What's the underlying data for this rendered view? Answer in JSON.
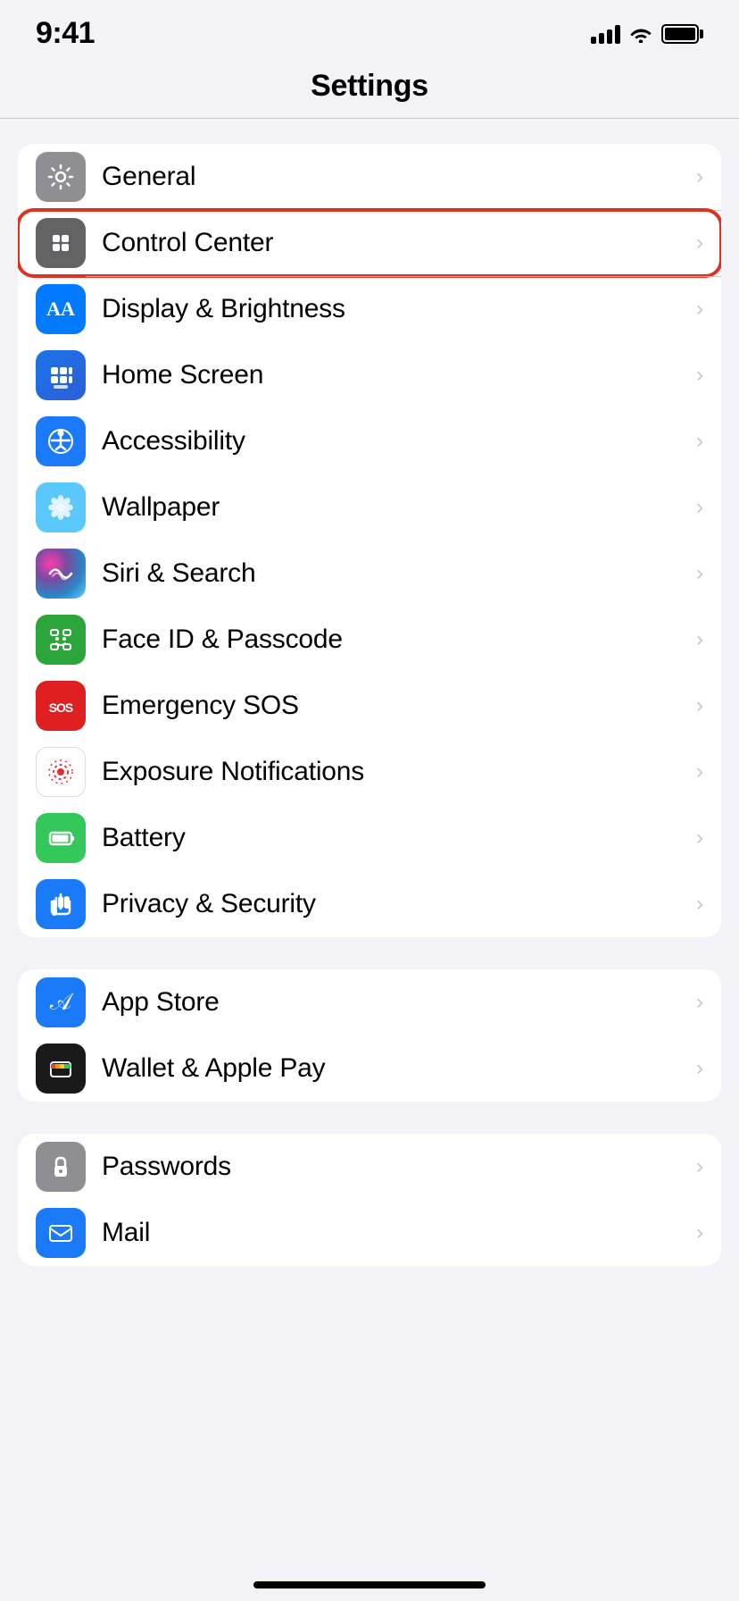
{
  "statusBar": {
    "time": "9:41",
    "signal": 4,
    "wifi": true,
    "battery": 100
  },
  "header": {
    "title": "Settings"
  },
  "groups": [
    {
      "id": "system",
      "items": [
        {
          "id": "general",
          "label": "General",
          "iconColor": "gray",
          "highlighted": false
        },
        {
          "id": "control-center",
          "label": "Control Center",
          "iconColor": "gray2",
          "highlighted": true
        },
        {
          "id": "display-brightness",
          "label": "Display & Brightness",
          "iconColor": "blue",
          "highlighted": false
        },
        {
          "id": "home-screen",
          "label": "Home Screen",
          "iconColor": "blue2",
          "highlighted": false
        },
        {
          "id": "accessibility",
          "label": "Accessibility",
          "iconColor": "blue",
          "highlighted": false
        },
        {
          "id": "wallpaper",
          "label": "Wallpaper",
          "iconColor": "teal",
          "highlighted": false
        },
        {
          "id": "siri-search",
          "label": "Siri & Search",
          "iconColor": "siri",
          "highlighted": false
        },
        {
          "id": "face-id",
          "label": "Face ID & Passcode",
          "iconColor": "green-faceid",
          "highlighted": false
        },
        {
          "id": "emergency-sos",
          "label": "Emergency SOS",
          "iconColor": "red",
          "highlighted": false
        },
        {
          "id": "exposure-notifications",
          "label": "Exposure Notifications",
          "iconColor": "exposure",
          "highlighted": false
        },
        {
          "id": "battery",
          "label": "Battery",
          "iconColor": "green",
          "highlighted": false
        },
        {
          "id": "privacy-security",
          "label": "Privacy & Security",
          "iconColor": "blue-hand",
          "highlighted": false
        }
      ]
    },
    {
      "id": "store",
      "items": [
        {
          "id": "app-store",
          "label": "App Store",
          "iconColor": "appstore",
          "highlighted": false
        },
        {
          "id": "wallet",
          "label": "Wallet & Apple Pay",
          "iconColor": "wallet",
          "highlighted": false
        }
      ]
    },
    {
      "id": "apps",
      "items": [
        {
          "id": "passwords",
          "label": "Passwords",
          "iconColor": "password",
          "highlighted": false
        },
        {
          "id": "mail",
          "label": "Mail",
          "iconColor": "mail",
          "highlighted": false
        }
      ]
    }
  ],
  "chevron": "›"
}
